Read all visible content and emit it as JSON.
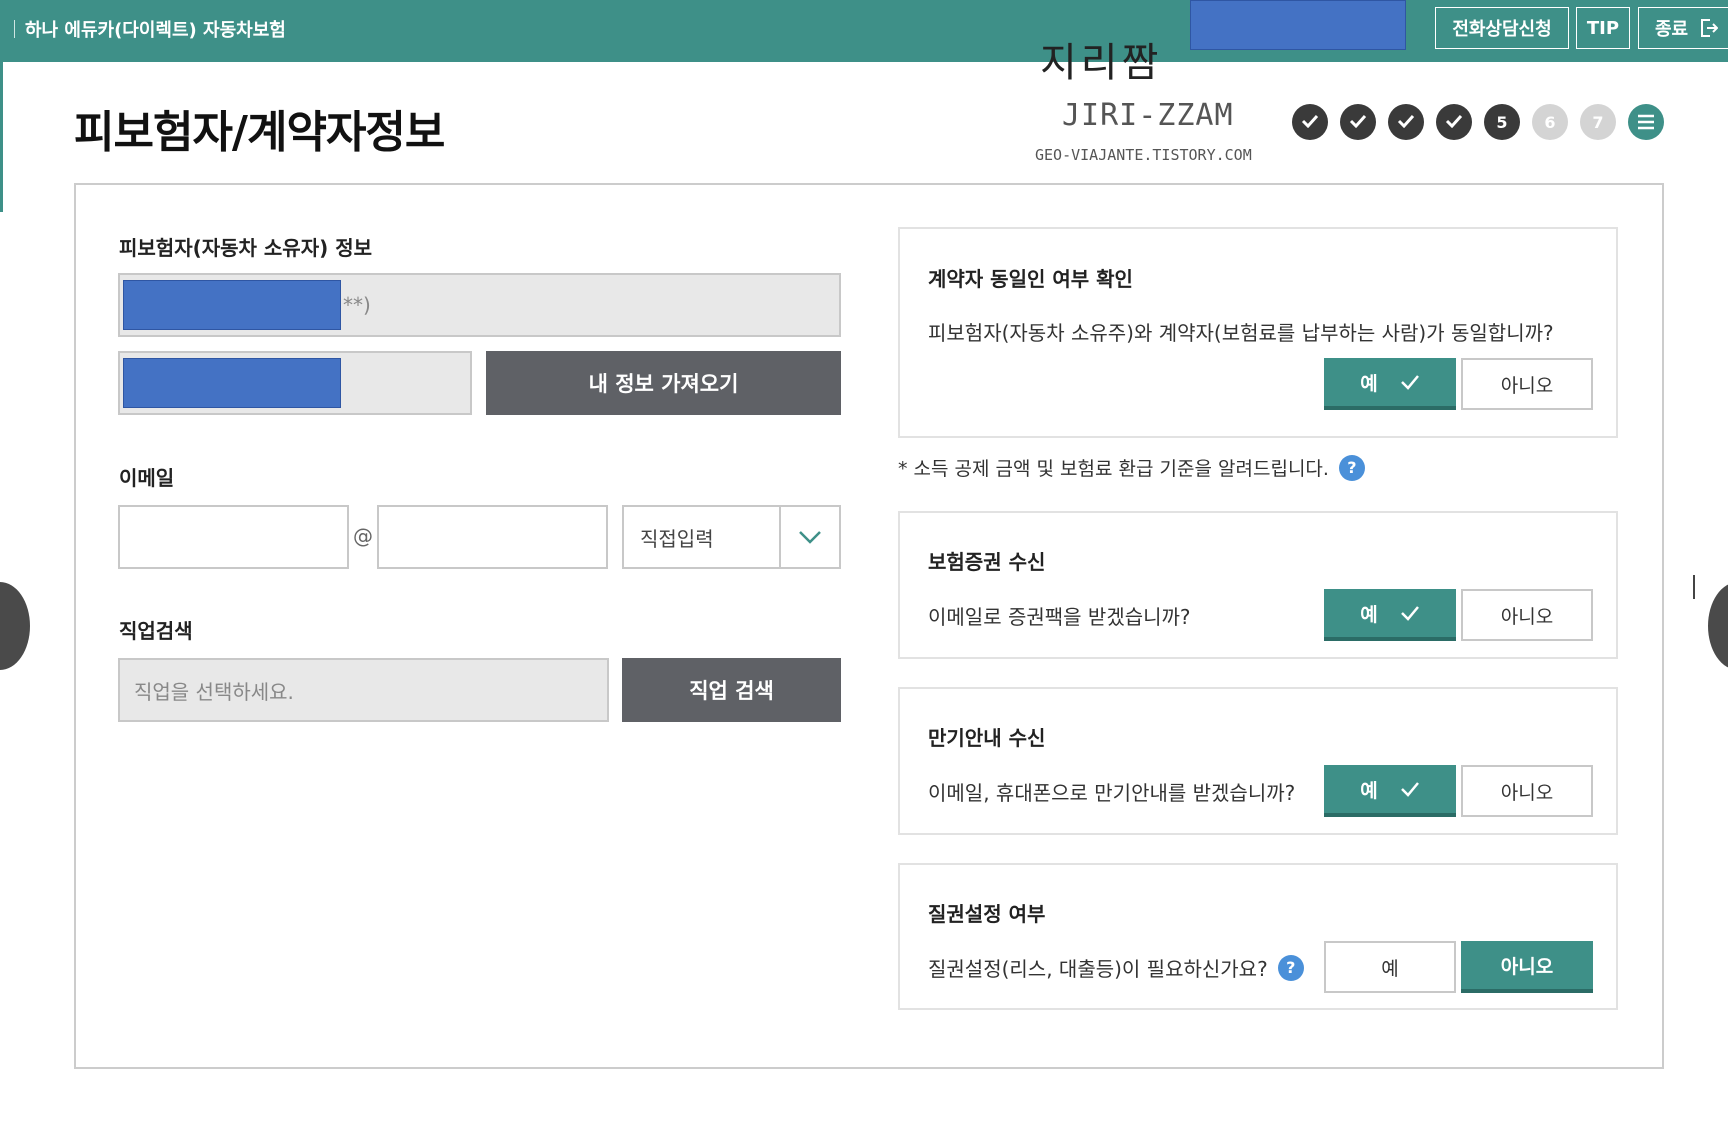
{
  "header": {
    "brand": "하나 에듀카(다이렉트) 자동차보험",
    "buttons": [
      {
        "label": "전화상담신청"
      },
      {
        "label": "TIP"
      },
      {
        "label": "종료"
      }
    ]
  },
  "watermark": {
    "handwritten": "지리짬",
    "name": "JIRI-ZZAM",
    "url": "GEO-VIAJANTE.TISTORY.COM"
  },
  "page": {
    "title": "피보험자/계약자정보"
  },
  "steps": [
    {
      "state": "done",
      "label": ""
    },
    {
      "state": "done",
      "label": ""
    },
    {
      "state": "done",
      "label": ""
    },
    {
      "state": "done",
      "label": ""
    },
    {
      "state": "current",
      "label": "5"
    },
    {
      "state": "todo",
      "label": "6"
    },
    {
      "state": "todo",
      "label": "7"
    },
    {
      "state": "menu",
      "label": ""
    }
  ],
  "insured": {
    "section_label": "피보험자(자동차 소유자) 정보",
    "name_suffix": "**)",
    "fetch_button": "내 정보 가져오기"
  },
  "email": {
    "label": "이메일",
    "at": "@",
    "domain_select": "직접입력"
  },
  "job": {
    "label": "직업검색",
    "placeholder": "직업을 선택하세요.",
    "search_button": "직업 검색"
  },
  "note": "* 소득 공제 금액 및 보험료 환급 기준을 알려드립니다.",
  "panels": {
    "same_contractor": {
      "title": "계약자 동일인 여부 확인",
      "question": "피보험자(자동차 소유주)와 계약자(보험료를 납부하는 사람)가 동일합니까?",
      "yes": "예",
      "no": "아니오"
    },
    "certificate": {
      "title": "보험증권 수신",
      "question": "이메일로 증권팩을 받겠습니까?",
      "yes": "예",
      "no": "아니오"
    },
    "expiry": {
      "title": "만기안내 수신",
      "question": "이메일, 휴대폰으로 만기안내를 받겠습니까?",
      "yes": "예",
      "no": "아니오"
    },
    "pledge": {
      "title": "질권설정 여부",
      "question": "질권설정(리스, 대출등)이 필요하신가요?",
      "yes": "예",
      "no": "아니오"
    }
  },
  "colors": {
    "teal": "#3e9088",
    "dark_button": "#5f6166",
    "redaction": "#4472c4"
  }
}
